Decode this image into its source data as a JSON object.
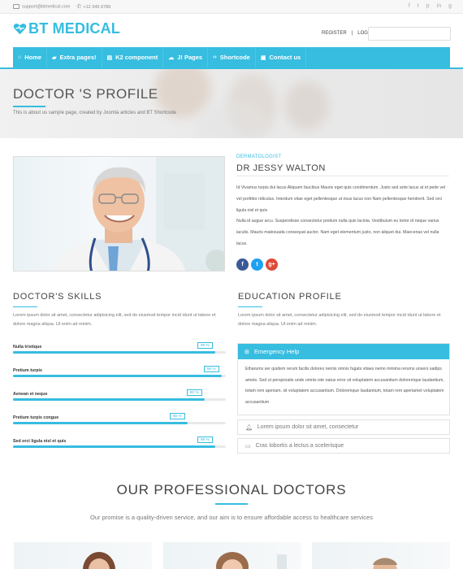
{
  "topbar": {
    "email": "support@btmedical.com",
    "phone": "+12 345 6789",
    "social": [
      "f",
      "t",
      "p",
      "in",
      "g"
    ]
  },
  "header": {
    "logo_text": "BT MEDICAL",
    "register": "REGISTER",
    "separator": "|",
    "login": "LOGIN",
    "search_placeholder": ""
  },
  "nav": {
    "items": [
      {
        "label": "Home",
        "icon": "home-icon",
        "glyph": "⌂"
      },
      {
        "label": "Extra pages!",
        "icon": "folder-icon",
        "glyph": "▰"
      },
      {
        "label": "K2 component",
        "icon": "list-icon",
        "glyph": "▤"
      },
      {
        "label": "J! Pages",
        "icon": "cloud-icon",
        "glyph": "☁"
      },
      {
        "label": "Shortcode",
        "icon": "code-icon",
        "glyph": "‹›"
      },
      {
        "label": "Contact us",
        "icon": "car-icon",
        "glyph": "▣"
      }
    ]
  },
  "banner": {
    "title": "DOCTOR 'S PROFILE",
    "subtitle": "This is about us sample page, created by Joomla articles and BT Shortcode"
  },
  "doctor": {
    "department": "DERMATOLOGIST",
    "name": "DR JESSY WALTON",
    "bio_1": "Id Vivamus turpis dui lacus Aliquam faucibus Mauris eget quis condimentum. Justo sed ante lacus at et pede vel vel porttitor ridiculus. Interdum vitae eget pellentesque ut risus lacus non Nam pellentesque hendrerit. Sed orci ligula nisl et quis",
    "bio_2": "Nulla id augue arcu. Suspendisse consectetur pretium nulla quis lacinia. Vestibulum eu tortor id neque varius iaculis. Mauris malesuada consequat auctor. Nam eget elementum justo, non aliquet dui. Maecenas vel nulla lacus.",
    "social": [
      {
        "letter": "f",
        "color": "#3b5998",
        "name": "facebook-icon"
      },
      {
        "letter": "t",
        "color": "#1da1f2",
        "name": "twitter-icon"
      },
      {
        "letter": "g+",
        "color": "#dd4b39",
        "name": "google-plus-icon"
      }
    ]
  },
  "skills": {
    "heading": "DOCTOR'S SKILLS",
    "text": "Lorem ipsum dolor sit amet, consectetur adipisicing elit, sed do eiusmod tempor incid idunt ut labore et dolore magna aliqua. Ut enim ad minim.",
    "items": [
      {
        "label": "Nulla tristique",
        "percent": 95,
        "display": "95 %"
      },
      {
        "label": "Pretium turpis",
        "percent": 98,
        "display": "98 %"
      },
      {
        "label": "Aenean et neque",
        "percent": 90,
        "display": "90 %"
      },
      {
        "label": "Pretium turpis congue",
        "percent": 82,
        "display": "85 %"
      },
      {
        "label": "Sed orci ligula nisl et quis",
        "percent": 95,
        "display": "98 %"
      }
    ]
  },
  "education": {
    "heading": "EDUCATION PROFILE",
    "text": "Lorem ipsum dolor sit amet, consectetur adipisicing elit, sed do eiusmod tempor incid idunt ut labore et dolore magna aliqua. Ut enim ad minim.",
    "panel_title": "Emergency Help",
    "panel_body": "Etharums ser quidem rerum facilis dolores nemis omnis fugats vitaes nemo minima rerums unsers sadips amets. Sed ut perspiciatis unde omnis iste natus error sit voluptatem accusantium doloremque laudantium, totam rem aperiam. sit voluptatem accusantium. Doloremque laudantium, totam rem aperiamet voluptatem accusantium",
    "item_1": "Lorem ipsum dolor sit amet, consectetur",
    "item_2": "Cras lobortis a lectus a scelerisque"
  },
  "professional": {
    "heading": "OUR PROFESSIONAL DOCTORS",
    "subtitle": "Our promise is a quality-driven service, and our aim is to ensure affordable access to healthcare services"
  },
  "colors": {
    "accent": "#36bde0"
  }
}
